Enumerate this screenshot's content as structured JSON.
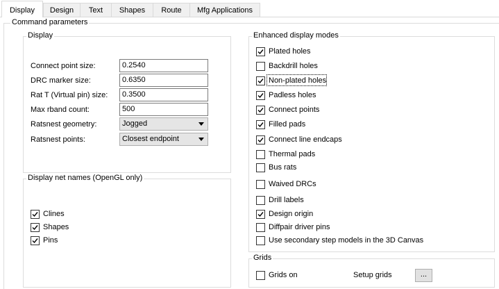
{
  "tabs": [
    {
      "label": "Display"
    },
    {
      "label": "Design"
    },
    {
      "label": "Text"
    },
    {
      "label": "Shapes"
    },
    {
      "label": "Route"
    },
    {
      "label": "Mfg Applications"
    }
  ],
  "command_parameters": {
    "title": "Command parameters",
    "display": {
      "title": "Display",
      "connect_point_size": {
        "label": "Connect point size:",
        "value": "0.2540"
      },
      "drc_marker_size": {
        "label": "DRC marker size:",
        "value": "0.6350"
      },
      "rat_t_size": {
        "label": "Rat T (Virtual pin) size:",
        "value": "0.3500"
      },
      "max_rband_count": {
        "label": "Max rband count:",
        "value": "500"
      },
      "ratsnest_geometry": {
        "label": "Ratsnest geometry:",
        "value": "Jogged"
      },
      "ratsnest_points": {
        "label": "Ratsnest points:",
        "value": "Closest endpoint"
      }
    },
    "net_names": {
      "title": "Display net names (OpenGL only)",
      "items": [
        {
          "label": "Clines",
          "checked": true
        },
        {
          "label": "Shapes",
          "checked": true
        },
        {
          "label": "Pins",
          "checked": true
        }
      ]
    }
  },
  "enhanced": {
    "title": "Enhanced display modes",
    "items": [
      {
        "label": "Plated holes",
        "checked": true
      },
      {
        "label": "Backdrill holes",
        "checked": false
      },
      {
        "label": "Non-plated holes",
        "checked": true
      },
      {
        "label": "Padless holes",
        "checked": true
      },
      {
        "label": "Connect points",
        "checked": true
      },
      {
        "label": "Filled pads",
        "checked": true
      },
      {
        "label": "Connect line endcaps",
        "checked": true
      },
      {
        "label": "Thermal pads",
        "checked": false
      },
      {
        "label": "Bus rats",
        "checked": false
      },
      {
        "label": "Waived DRCs",
        "checked": false
      },
      {
        "label": "Drill labels",
        "checked": false
      },
      {
        "label": "Design origin",
        "checked": true
      },
      {
        "label": "Diffpair driver pins",
        "checked": false
      },
      {
        "label": "Use secondary step models in the 3D Canvas",
        "checked": false
      }
    ]
  },
  "grids": {
    "title": "Grids",
    "grids_on": {
      "label": "Grids on",
      "checked": false
    },
    "setup_label": "Setup grids",
    "button_label": "..."
  }
}
